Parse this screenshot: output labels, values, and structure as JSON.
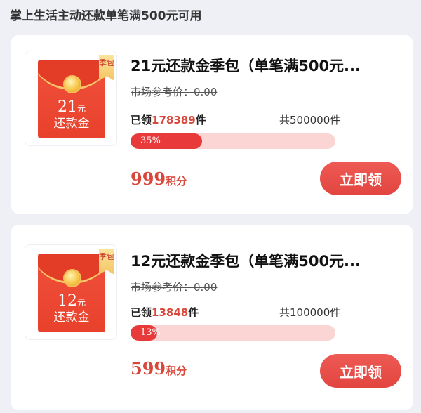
{
  "header": {
    "title": "掌上生活主动还款单笔满500元可用"
  },
  "products": [
    {
      "thumb": {
        "amount": "21",
        "amount_unit": "元",
        "label": "还款金",
        "ribbon": "季包"
      },
      "title": "21元还款金季包（单笔满500元...",
      "market_price": "市场参考价：0.00",
      "claimed_prefix": "已领",
      "claimed_count": "178389",
      "claimed_suffix": "件",
      "total": "共500000件",
      "progress_percent": 35,
      "progress_label": "35%",
      "points_value": "999",
      "points_unit": "积分",
      "button_label": "立即领"
    },
    {
      "thumb": {
        "amount": "12",
        "amount_unit": "元",
        "label": "还款金",
        "ribbon": "季包"
      },
      "title": "12元还款金季包（单笔满500元...",
      "market_price": "市场参考价：0.00",
      "claimed_prefix": "已领",
      "claimed_count": "13848",
      "claimed_suffix": "件",
      "total": "共100000件",
      "progress_percent": 13,
      "progress_label": "13%",
      "points_value": "599",
      "points_unit": "积分",
      "button_label": "立即领"
    }
  ],
  "colors": {
    "accent": "#d9473b",
    "button": "#e2453f",
    "progress_track": "#fbd4d4"
  }
}
